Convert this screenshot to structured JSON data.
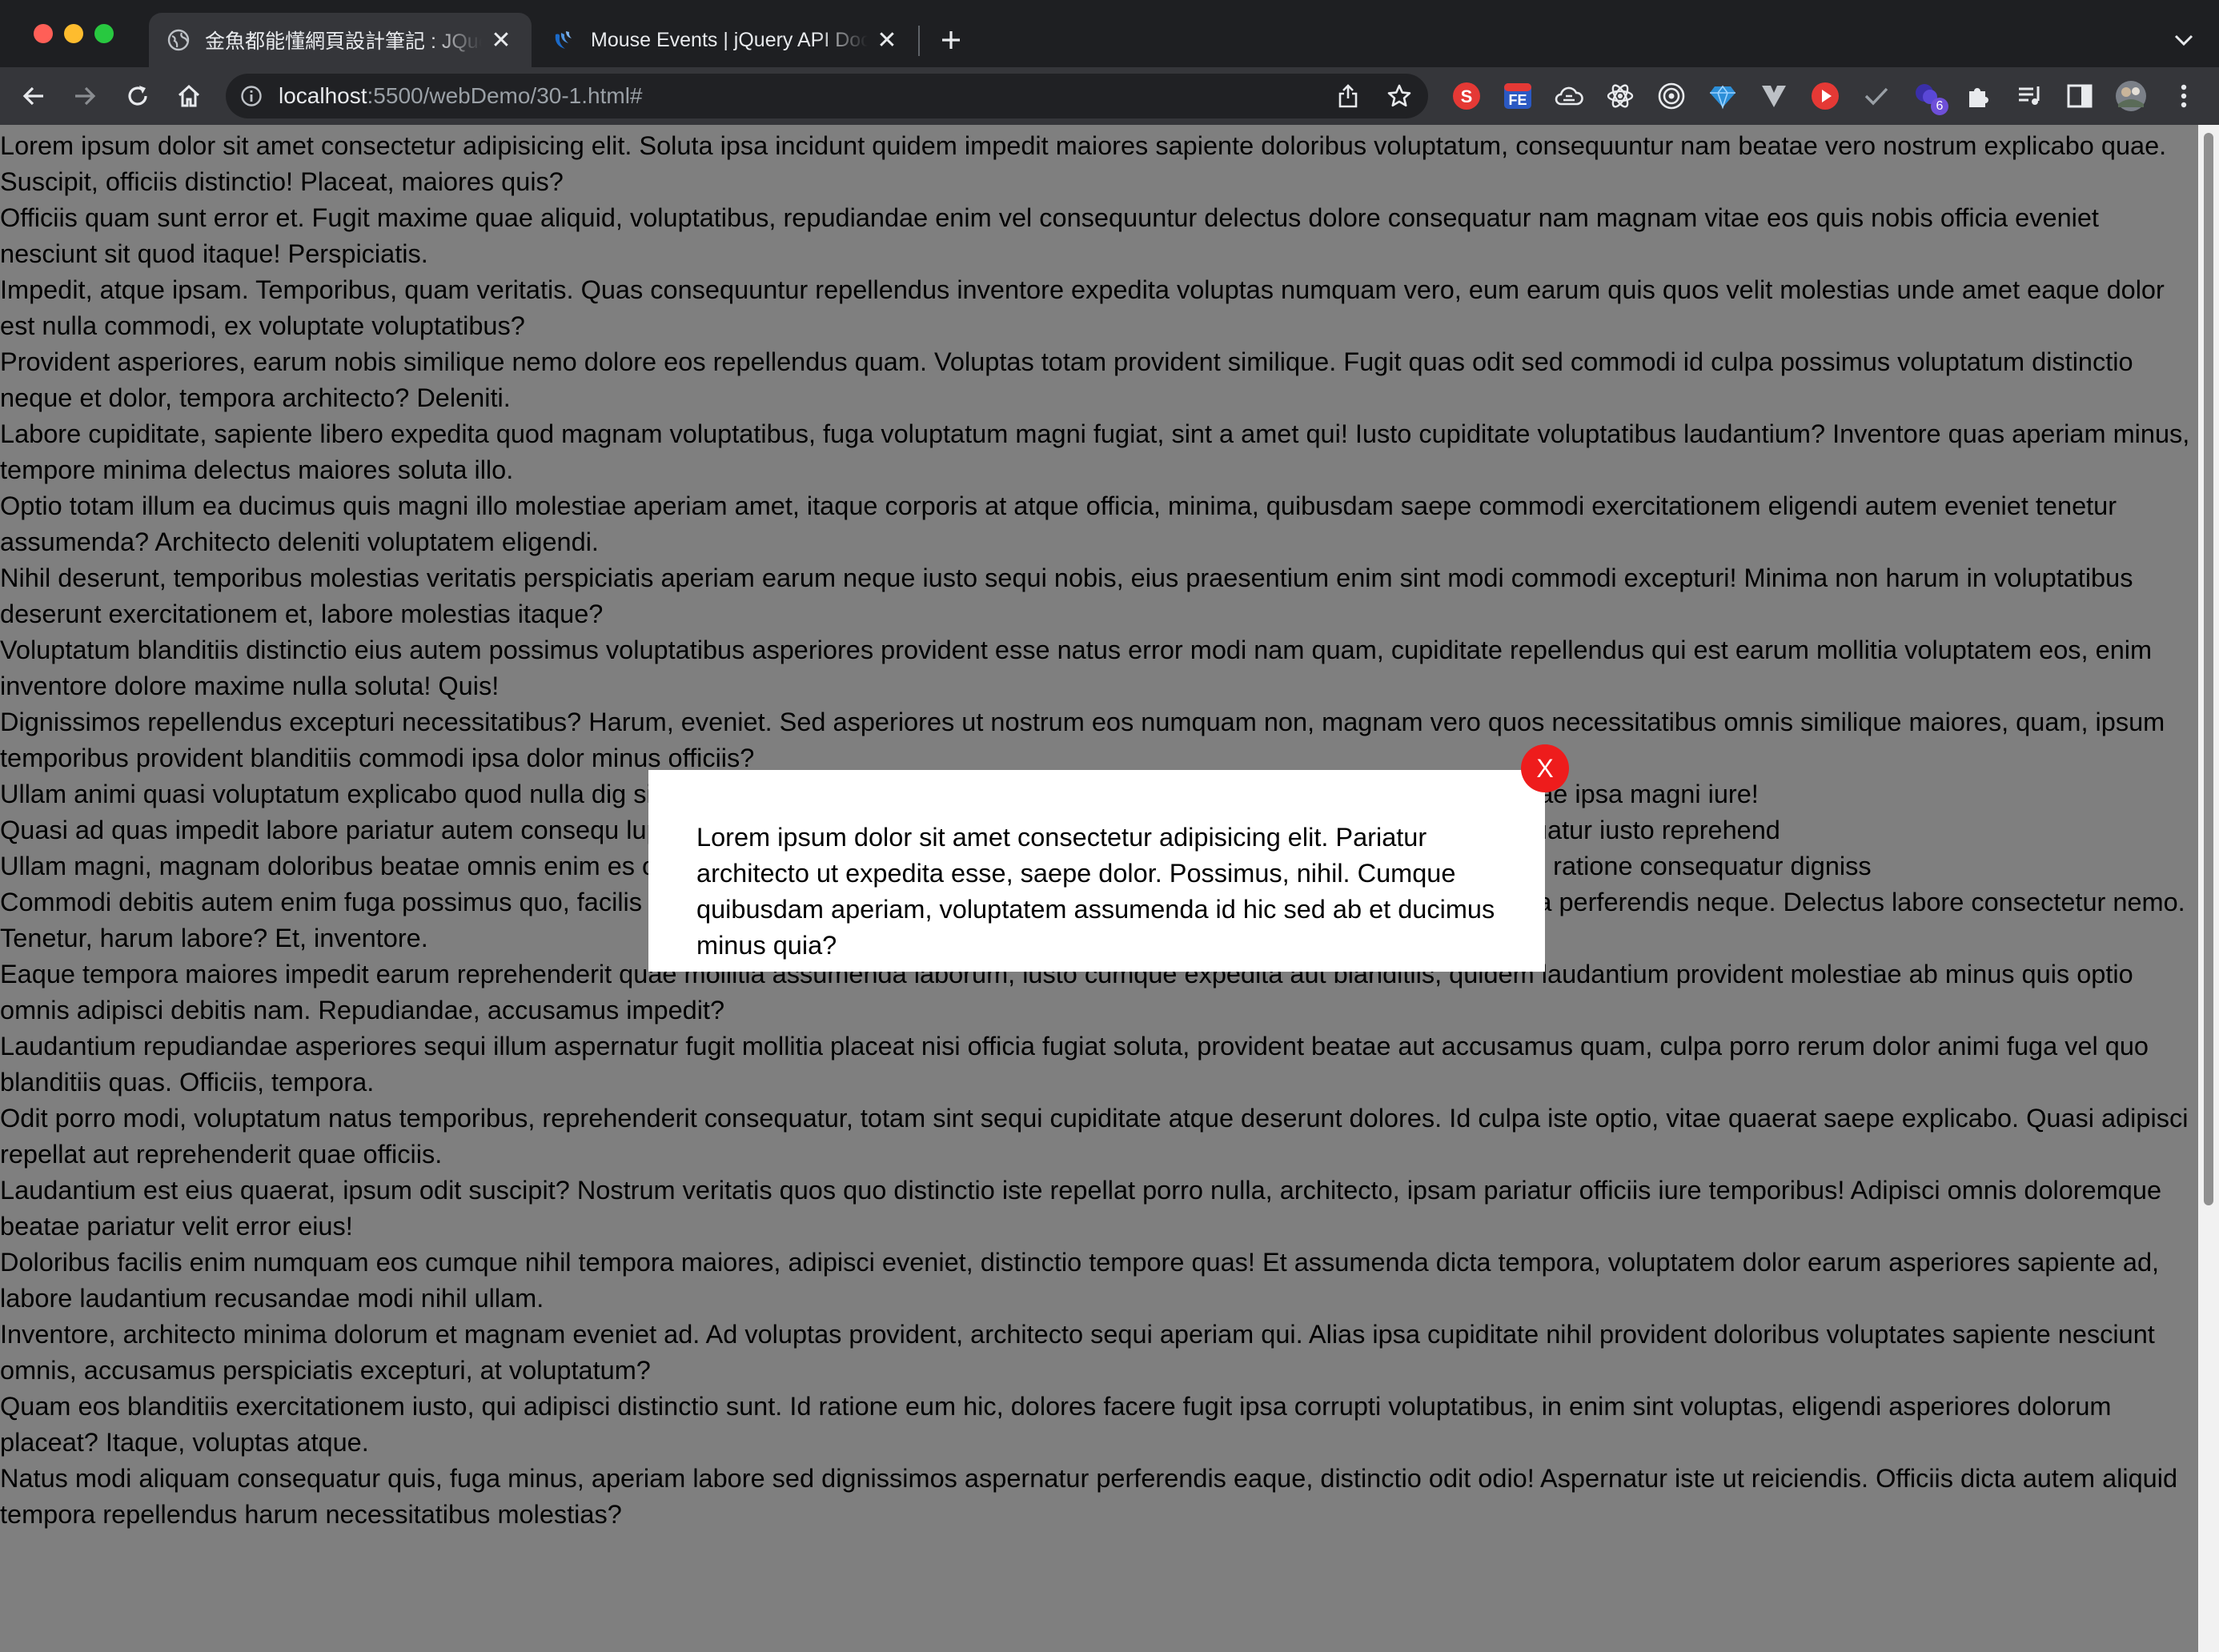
{
  "browser": {
    "tabs": [
      {
        "title": "金魚都能懂網頁設計筆記 : JQuery",
        "active": true
      },
      {
        "title": "Mouse Events | jQuery API Documentation",
        "active": false
      }
    ],
    "url": {
      "host": "localhost",
      "path": ":5500/webDemo/30-1.html#"
    },
    "extensions": [
      "S",
      "FE",
      "cloud-icon",
      "atom-icon",
      "target-icon",
      "diamond-icon",
      "v-icon",
      "play-icon",
      "check-icon",
      "puzzle-badge-icon",
      "extensions-icon",
      "reading-list-icon",
      "side-panel-icon",
      "avatar",
      "menu-icon"
    ],
    "extension_badge": "6"
  },
  "page": {
    "paragraphs": [
      "Lorem ipsum dolor sit amet consectetur adipisicing elit. Soluta ipsa incidunt quidem impedit maiores sapiente doloribus voluptatum, consequuntur nam beatae vero nostrum explicabo quae. Suscipit, officiis distinctio! Placeat, maiores quis?",
      "Officiis quam sunt error et. Fugit maxime quae aliquid, voluptatibus, repudiandae enim vel consequuntur delectus dolore consequatur nam magnam vitae eos quis nobis officia eveniet nesciunt sit quod itaque! Perspiciatis.",
      "Impedit, atque ipsam. Temporibus, quam veritatis. Quas consequuntur repellendus inventore expedita voluptas numquam vero, eum earum quis quos velit molestias unde amet eaque dolor est nulla commodi, ex voluptate voluptatibus?",
      "Provident asperiores, earum nobis similique nemo dolore eos repellendus quam. Voluptas totam provident similique. Fugit quas odit sed commodi id culpa possimus voluptatum distinctio neque et dolor, tempora architecto? Deleniti.",
      "Labore cupiditate, sapiente libero expedita quod magnam voluptatibus, fuga voluptatum magni fugiat, sint a amet qui! Iusto cupiditate voluptatibus laudantium? Inventore quas aperiam minus, tempore minima delectus maiores soluta illo.",
      "Optio totam illum ea ducimus quis magni illo molestiae aperiam amet, itaque corporis at atque officia, minima, quibusdam saepe commodi exercitationem eligendi autem eveniet tenetur assumenda? Architecto deleniti voluptatem eligendi.",
      "Nihil deserunt, temporibus molestias veritatis perspiciatis aperiam earum neque iusto sequi nobis, eius praesentium enim sint modi commodi excepturi! Minima non harum in voluptatibus deserunt exercitationem et, labore molestias itaque?",
      "Voluptatum blanditiis distinctio eius autem possimus voluptatibus asperiores provident esse natus error modi nam quam, cupiditate repellendus qui est earum mollitia voluptatem eos, enim inventore dolore maxime nulla soluta! Quis!",
      "Dignissimos repellendus excepturi necessitatibus? Harum, eveniet. Sed asperiores ut nostrum eos numquam non, magnam vero quos necessitatibus omnis similique maiores, quam, ipsum temporibus provident blanditiis commodi ipsa dolor minus officiis?",
      "Ullam animi quasi voluptatum explicabo quod nulla dig sint quibusdam sit beatae alias? Harum delectus voluptatibus facere nulla beatae ipsa magni iure!",
      "Quasi ad quas impedit labore pariatur autem consequ luptas commodi mollitia repellat iste fugit ipsa placeat tenetur dolorum. Consequatur iusto reprehend",
      "Ullam magni, magnam doloribus beatae omnis enim es ostrum ad eius recusandae aliquid itaque possimus quasi earum maiores ipsa, ratione consequatur digniss",
      "Commodi debitis autem enim fuga possimus quo, facilis voluptates ab magni deserunt quae velit molestiae vitae placeat blanditiis nulla perferendis neque. Delectus labore consectetur nemo. Tenetur, harum labore? Et, inventore.",
      "Eaque tempora maiores impedit earum reprehenderit quae mollitia assumenda laborum, iusto cumque expedita aut blanditiis, quidem laudantium provident molestiae ab minus quis optio omnis adipisci debitis nam. Repudiandae, accusamus impedit?",
      "Laudantium repudiandae asperiores sequi illum aspernatur fugit mollitia placeat nisi officia fugiat soluta, provident beatae aut accusamus quam, culpa porro rerum dolor animi fuga vel quo blanditiis quas. Officiis, tempora.",
      "Odit porro modi, voluptatum natus temporibus, reprehenderit consequatur, totam sint sequi cupiditate atque deserunt dolores. Id culpa iste optio, vitae quaerat saepe explicabo. Quasi adipisci repellat aut reprehenderit quae officiis.",
      "Laudantium est eius quaerat, ipsum odit suscipit? Nostrum veritatis quos quo distinctio iste repellat porro nulla, architecto, ipsam pariatur officiis iure temporibus! Adipisci omnis doloremque beatae pariatur velit error eius!",
      "Doloribus facilis enim numquam eos cumque nihil tempora maiores, adipisci eveniet, distinctio tempore quas! Et assumenda dicta tempora, voluptatem dolor earum asperiores sapiente ad, labore laudantium recusandae modi nihil ullam.",
      "Inventore, architecto minima dolorum et magnam eveniet ad. Ad voluptas provident, architecto sequi aperiam qui. Alias ipsa cupiditate nihil provident doloribus voluptates sapiente nesciunt omnis, accusamus perspiciatis excepturi, at voluptatum?",
      "Quam eos blanditiis exercitationem iusto, qui adipisci distinctio sunt. Id ratione eum hic, dolores facere fugit ipsa corrupti voluptatibus, in enim sint voluptas, eligendi asperiores dolorum placeat? Itaque, voluptas atque.",
      "Natus modi aliquam consequatur quis, fuga minus, aperiam labore sed dignissimos aspernatur perferendis eaque, distinctio odit odio! Aspernatur iste ut reiciendis. Officiis dicta autem aliquid tempora repellendus harum necessitatibus molestias?"
    ]
  },
  "modal": {
    "text": "Lorem ipsum dolor sit amet consectetur adipisicing elit. Pariatur architecto ut expedita esse, saepe dolor. Possimus, nihil. Cumque quibusdam aperiam, voluptatem assumenda id hic sed ab et ducimus minus quia?",
    "close_label": "X"
  },
  "colors": {
    "titlebar": "#1e1f22",
    "toolbar": "#35363a",
    "overlay": "rgba(0,0,0,0.5)",
    "close_button": "#ee1c1c"
  }
}
